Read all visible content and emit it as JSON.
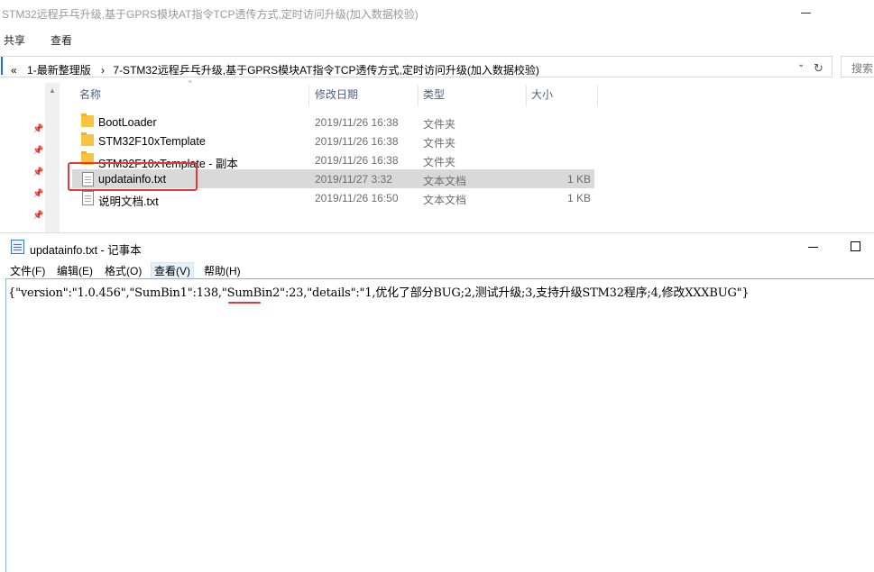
{
  "explorer": {
    "title": "STM32远程乒乓升级,基于GPRS模块AT指令TCP透传方式,定时访问升级(加入数据校验)",
    "ribbon_tabs": [
      "共享",
      "查看"
    ],
    "address": {
      "prefix": "«",
      "parts": [
        "1-最新整理版",
        "›",
        "7-STM32远程乒乓升级,基于GPRS模块AT指令TCP透传方式,定时访问升级(加入数据校验)"
      ],
      "search_label": "搜索"
    },
    "columns": {
      "name": "名称",
      "date": "修改日期",
      "type": "类型",
      "size": "大小"
    },
    "files": [
      {
        "name": "BootLoader",
        "date": "2019/11/26 16:38",
        "type": "文件夹",
        "size": "",
        "icon": "folder-icon",
        "selected": false
      },
      {
        "name": "STM32F10xTemplate",
        "date": "2019/11/26 16:38",
        "type": "文件夹",
        "size": "",
        "icon": "folder-icon",
        "selected": false
      },
      {
        "name": "STM32F10xTemplate - 副本",
        "date": "2019/11/26 16:38",
        "type": "文件夹",
        "size": "",
        "icon": "folder-icon",
        "selected": false
      },
      {
        "name": "updatainfo.txt",
        "date": "2019/11/27 3:32",
        "type": "文本文档",
        "size": "1 KB",
        "icon": "txt-file-icon",
        "selected": true
      },
      {
        "name": "说明文档.txt",
        "date": "2019/11/26 16:50",
        "type": "文本文档",
        "size": "1 KB",
        "icon": "txt-file-icon",
        "selected": false
      }
    ]
  },
  "notepad": {
    "title": "updatainfo.txt - 记事本",
    "menu": [
      "文件(F)",
      "编辑(E)",
      "格式(O)",
      "查看(V)",
      "帮助(H)"
    ],
    "active_menu": "查看(V)",
    "content": "{\"version\":\"1.0.456\",\"SumBin1\":138,\"SumBin2\":23,\"details\":\"1,优化了部分BUG;2,测试升级;3,支持升级STM32程序;4,修改XXXBUG\"}"
  },
  "colors": {
    "highlight_red": "#e53935",
    "selected_row": "#d9d9d9",
    "header_text": "#4c607a"
  }
}
